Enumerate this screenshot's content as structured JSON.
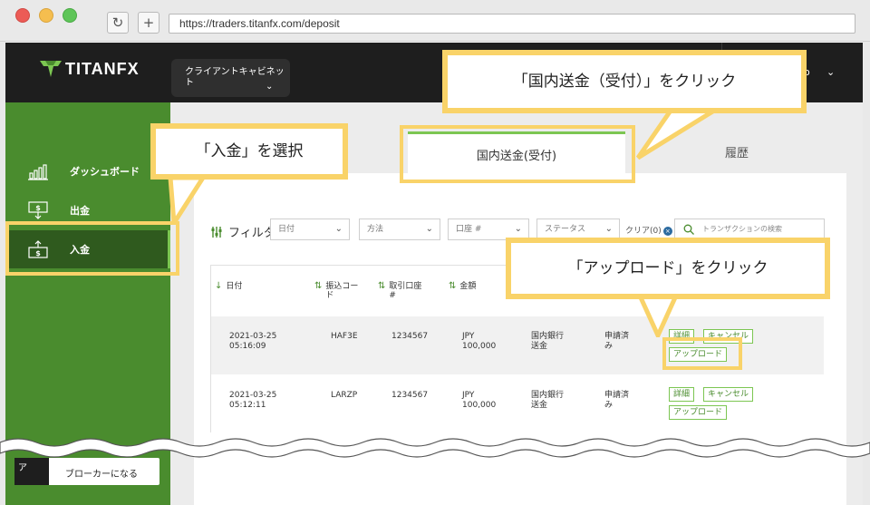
{
  "browser": {
    "url": "https://traders.titanfx.com/deposit"
  },
  "header": {
    "logo_text": "TITANFX",
    "cabinet_label": "クライアントキャビネット",
    "user_name": "ato"
  },
  "sidebar": {
    "items": [
      {
        "label": "ダッシュボード",
        "icon": "bar-chart-icon"
      },
      {
        "label": "出金",
        "icon": "withdraw-icon"
      },
      {
        "label": "入金",
        "icon": "deposit-icon"
      }
    ],
    "broker_label": "ブローカーになる",
    "broker_prefix": "ア"
  },
  "tabs": {
    "active": "国内送金(受付)",
    "history": "履歴"
  },
  "filters": {
    "label": "フィルタ",
    "date": "日付",
    "method": "方法",
    "account": "口座 #",
    "status": "ステータス",
    "clear": "クリア(0)",
    "search_placeholder": "トランザクションの検索"
  },
  "table": {
    "headers": [
      "日付",
      "振込コード",
      "取引口座 #",
      "金額"
    ],
    "rows": [
      {
        "date": "2021-03-25",
        "time": "05:16:09",
        "code": "HAF3E",
        "account": "1234567",
        "currency": "JPY",
        "amount": "100,000",
        "method": "国内銀行送金",
        "status": "申請済み"
      },
      {
        "date": "2021-03-25",
        "time": "05:12:11",
        "code": "LARZP",
        "account": "1234567",
        "currency": "JPY",
        "amount": "100,000",
        "method": "国内銀行送金",
        "status": "申請済み"
      }
    ],
    "actions": {
      "details": "詳細",
      "cancel": "キャンセル",
      "upload": "アップロード"
    }
  },
  "callouts": {
    "select_deposit": "「入金」を選択",
    "click_domestic": "「国内送金（受付）」をクリック",
    "click_upload": "「アップロード」をクリック"
  },
  "colors": {
    "brand_green": "#4a8c2e",
    "active_green": "#2f5a1e",
    "accent_green": "#7cc652",
    "callout_yellow": "#f9d369",
    "header_dark": "#1e1e1e"
  }
}
